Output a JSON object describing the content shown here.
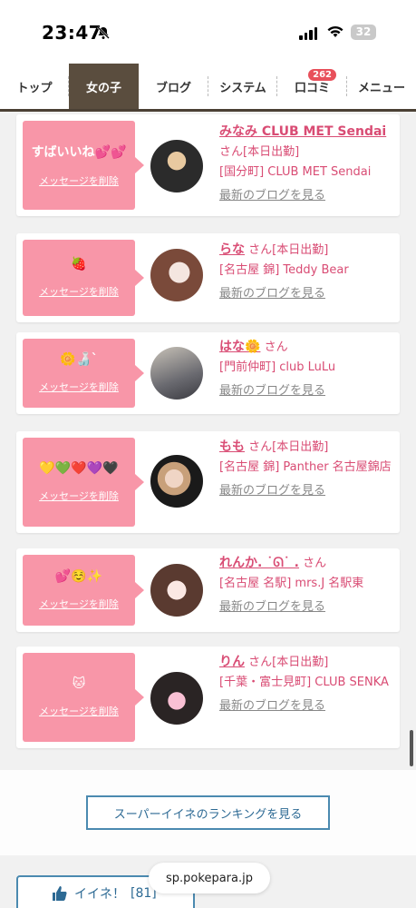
{
  "status_bar": {
    "time": "23:47",
    "battery": "32"
  },
  "nav": {
    "tabs": [
      {
        "label": "トップ"
      },
      {
        "label": "女の子"
      },
      {
        "label": "ブログ"
      },
      {
        "label": "システム"
      },
      {
        "label": "口コミ",
        "badge": "262"
      },
      {
        "label": "メニュー"
      }
    ]
  },
  "cards": [
    {
      "message": "すばいいね💕💕",
      "delete_label": "メッセージを削除",
      "name": "みなみ CLUB MET Sendai",
      "san": "さん",
      "status": "[本日出勤]",
      "shop": "[国分町] CLUB MET Sendai",
      "blog_link": "最新のブログを見る"
    },
    {
      "message": "🍓",
      "delete_label": "メッセージを削除",
      "name": "らな",
      "san": "さん",
      "status": "[本日出勤]",
      "shop": "[名古屋 錦] Teddy Bear",
      "blog_link": "最新のブログを見る"
    },
    {
      "message": "🌼🍶`",
      "delete_label": "メッセージを削除",
      "name": "はな🌼",
      "san": "さん",
      "status": "",
      "shop": "[門前仲町] club LuLu",
      "blog_link": "最新のブログを見る"
    },
    {
      "message": "💛💚❤️💜🖤",
      "delete_label": "メッセージを削除",
      "name": "もも",
      "san": "さん",
      "status": "[本日出勤]",
      "shop": "[名古屋 錦] Panther 名古屋錦店",
      "blog_link": "最新のブログを見る"
    },
    {
      "message": "💕☺️✨",
      "delete_label": "メッセージを削除",
      "name": "れんか. ˙ᘏ˙ .",
      "san": "さん",
      "status": "",
      "shop": "[名古屋 名駅] mrs.J 名駅東",
      "blog_link": "最新のブログを見る"
    },
    {
      "message": "🐱",
      "delete_label": "メッセージを削除",
      "name": "りん",
      "san": "さん",
      "status": "[本日出勤]",
      "shop": "[千葉・富士見町] CLUB SENKA",
      "blog_link": "最新のブログを見る"
    }
  ],
  "ranking_button": "スーパーイイネのランキングを見る",
  "iine_button": {
    "label": "イイネ！",
    "count": "[81]"
  },
  "url": "sp.pokepara.jp",
  "colors": {
    "accent": "#d94c74",
    "bubble": "#f896a8",
    "nav_active": "#5a4d3e",
    "button_border": "#4b8ab0"
  }
}
